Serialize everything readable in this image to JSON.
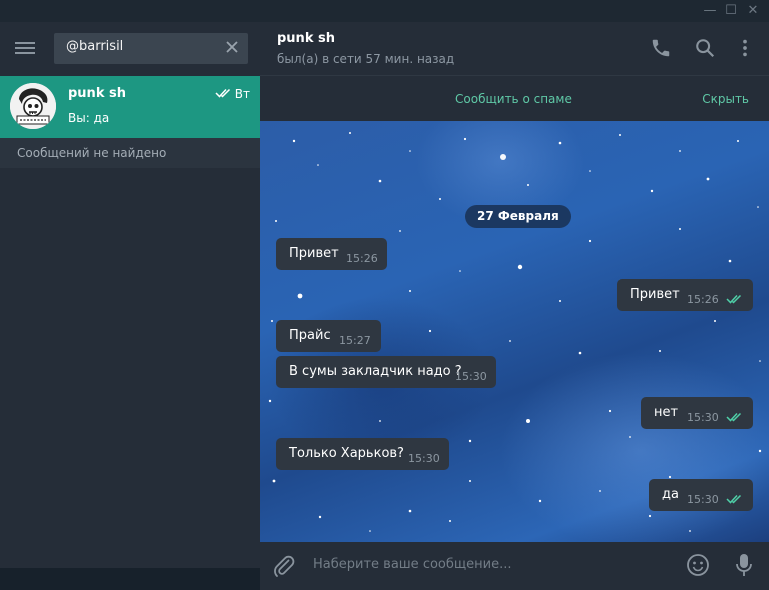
{
  "window": {
    "minimize_glyph": "—",
    "maximize_glyph": "☐",
    "close_glyph": "✕"
  },
  "sidebar": {
    "search": {
      "value": "@barrisil",
      "placeholder": ""
    },
    "chat": {
      "name": "punk sh",
      "time": "Вт",
      "preview": "Вы: да",
      "read_status_icon": "double-check-icon"
    },
    "no_results": "Сообщений не найдено"
  },
  "header": {
    "peer_name": "punk sh",
    "peer_status": "был(а) в сети 57 мин. назад",
    "icons": [
      "phone-icon",
      "search-icon",
      "more-vertical-icon"
    ]
  },
  "spam_bar": {
    "report_label": "Сообщить о спаме",
    "hide_label": "Скрыть"
  },
  "messages": {
    "date": "27 Февраля",
    "items": [
      {
        "direction": "in",
        "text": "Привет",
        "time": "15:26"
      },
      {
        "direction": "out",
        "text": "Привет",
        "time": "15:26"
      },
      {
        "direction": "in",
        "text": "Прайс",
        "time": "15:27"
      },
      {
        "direction": "in",
        "text": "В сумы закладчик надо ?",
        "time": "15:30"
      },
      {
        "direction": "out",
        "text": "нет",
        "time": "15:30"
      },
      {
        "direction": "in",
        "text": "Только Харьков?",
        "time": "15:30"
      },
      {
        "direction": "out",
        "text": "да",
        "time": "15:30"
      }
    ]
  },
  "composer": {
    "placeholder": "Наберите ваше сообщение..."
  },
  "colors": {
    "accent": "#1d9782",
    "link": "#5fc8a6",
    "tick": "#4fd0a8",
    "panel": "#252d38",
    "bubble": "#2f3741"
  }
}
